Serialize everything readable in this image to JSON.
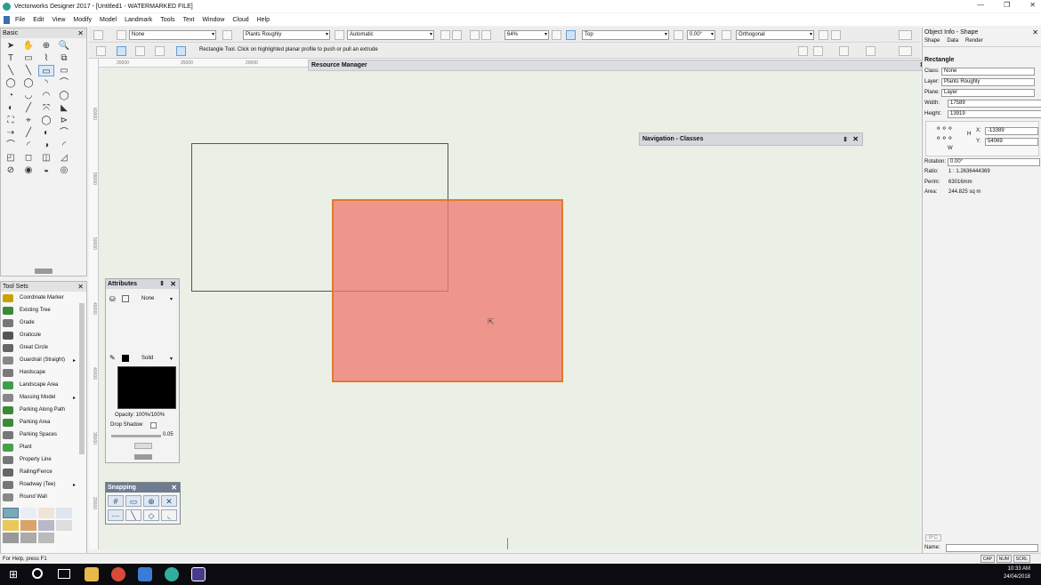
{
  "window": {
    "title": "Vectorworks Designer 2017 - [Untitled1 - WATERMARKED FILE]",
    "controls": [
      "—",
      "❐",
      "✕"
    ]
  },
  "menu": [
    "File",
    "Edit",
    "View",
    "Modify",
    "Model",
    "Landmark",
    "Tools",
    "Text",
    "Window",
    "Cloud",
    "Help"
  ],
  "toolbar": {
    "class_value": "None",
    "layer_value": "Plants Roughly",
    "render_value": "Automatic",
    "zoom_value": "64%",
    "view_value": "Top",
    "rotation_value": "0.00°",
    "projection_value": "Orthogonal"
  },
  "mode_bar": {
    "hint": "Rectangle Tool. Click on highlighted planar profile to push or pull an extrude"
  },
  "rulers": {
    "top": [
      "20000",
      "25000",
      "20000"
    ],
    "left": [
      "60000",
      "55000",
      "50000",
      "45000",
      "40000",
      "35000",
      "20000"
    ]
  },
  "basic_palette": {
    "title": "Basic",
    "tools": [
      "➤",
      "✋",
      "⊕",
      "🔍",
      "T",
      "▭",
      "⌇",
      "⧉",
      "╲",
      "╲",
      "▭",
      "▭",
      "◯",
      "◯",
      "◝",
      "⌒",
      "◔",
      "◡",
      "◠",
      "◯",
      "◐",
      "╱",
      "⤧",
      "◣",
      "⛶",
      "⌖",
      "◯",
      "⊳",
      "⇢",
      "╱",
      "◐",
      "⌒",
      "⌒",
      "◜",
      "◑",
      "◜",
      "◰",
      "◻",
      "◫",
      "◿",
      "⊘",
      "◉",
      "◒",
      "◎"
    ]
  },
  "tool_sets": {
    "title": "Tool Sets",
    "items": [
      {
        "label": "Coordinate Marker",
        "color": "#c8a200",
        "arrow": ""
      },
      {
        "label": "Existing Tree",
        "color": "#3a8a3a",
        "arrow": ""
      },
      {
        "label": "Grade",
        "color": "#777777",
        "arrow": ""
      },
      {
        "label": "Graticule",
        "color": "#555555",
        "arrow": ""
      },
      {
        "label": "Great Circle",
        "color": "#666666",
        "arrow": ""
      },
      {
        "label": "Guardrail (Straight)",
        "color": "#888888",
        "arrow": "▸"
      },
      {
        "label": "Hardscape",
        "color": "#7a7a7a",
        "arrow": ""
      },
      {
        "label": "Landscape Area",
        "color": "#3aa04a",
        "arrow": ""
      },
      {
        "label": "Massing Model",
        "color": "#888888",
        "arrow": "▸"
      },
      {
        "label": "Parking Along Path",
        "color": "#3a8a3a",
        "arrow": ""
      },
      {
        "label": "Parking Area",
        "color": "#3a8a3a",
        "arrow": ""
      },
      {
        "label": "Parking Spaces",
        "color": "#777777",
        "arrow": ""
      },
      {
        "label": "Plant",
        "color": "#4aa04a",
        "arrow": ""
      },
      {
        "label": "Property Line",
        "color": "#777777",
        "arrow": ""
      },
      {
        "label": "Railing/Fence",
        "color": "#666666",
        "arrow": ""
      },
      {
        "label": "Roadway (Tee)",
        "color": "#777777",
        "arrow": "▸"
      },
      {
        "label": "Round Wall",
        "color": "#888888",
        "arrow": ""
      }
    ]
  },
  "resource_manager": {
    "title": "Resource Manager"
  },
  "navigation": {
    "title": "Navigation - Classes"
  },
  "attributes": {
    "title": "Attributes",
    "fill_label": "None",
    "pen_label": "Solid",
    "opacity": "Opacity: 100%/100%",
    "drop_shadow": "Drop Shadow",
    "line_weight": "0.05"
  },
  "snapping": {
    "title": "Snapping"
  },
  "object_info": {
    "title": "Object Info - Shape",
    "tabs": [
      "Shape",
      "Data",
      "Render"
    ],
    "object_type": "Rectangle",
    "class": {
      "label": "Class:",
      "value": "None"
    },
    "layer": {
      "label": "Layer:",
      "value": "Plants Roughly"
    },
    "plane": {
      "label": "Plane:",
      "value": "Layer"
    },
    "width": {
      "label": "Width:",
      "value": "17589"
    },
    "height": {
      "label": "Height:",
      "value": "13919"
    },
    "x": {
      "label": "X:",
      "value": "-13389"
    },
    "y": {
      "label": "Y:",
      "value": "54069"
    },
    "h_label": "H",
    "w_label": "W",
    "rotation": {
      "label": "Rotation:",
      "value": "0.00°"
    },
    "ratio": {
      "label": "Ratio:",
      "value": "1 : 1.2636444369"
    },
    "perim": {
      "label": "Perim:",
      "value": "63016mm"
    },
    "area": {
      "label": "Area:",
      "value": "244.825 sq m"
    },
    "ifc": "IFC",
    "name_label": "Name:"
  },
  "status": {
    "help": "For Help, press F1",
    "keys": [
      "CAP",
      "NUM",
      "SCRL"
    ]
  },
  "taskbar": {
    "time": "10:33 AM",
    "date": "24/04/2018"
  }
}
